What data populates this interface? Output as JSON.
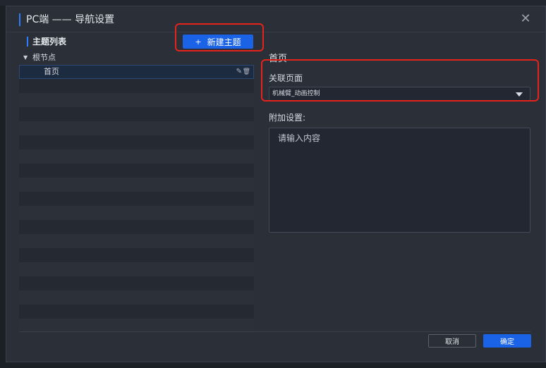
{
  "dialog": {
    "title": "PC端 —— 导航设置",
    "close_icon": "close-icon"
  },
  "left": {
    "topic_list_label": "主题列表",
    "new_topic_button": {
      "icon": "plus-icon",
      "plus_glyph": "+",
      "label": "新建主题"
    },
    "tree": {
      "root": {
        "label": "根节点",
        "expanded": true
      },
      "children": [
        {
          "label": "首页",
          "selected": true
        }
      ]
    }
  },
  "right": {
    "page_name": "首页",
    "assoc_label": "关联页面",
    "assoc_value": "机械臂_动画控制",
    "extra_label": "附加设置:",
    "extra_placeholder": "请输入内容"
  },
  "footer": {
    "cancel_label": "取消",
    "confirm_label": "确定"
  },
  "colors": {
    "accent": "#1a63e6",
    "highlight_box": "#e5231b",
    "panel_bg": "#2a2f38"
  }
}
